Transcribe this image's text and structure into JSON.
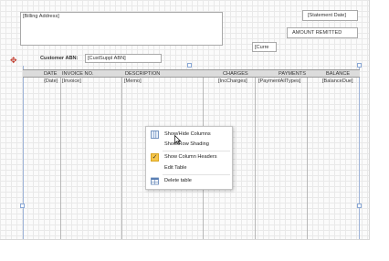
{
  "header": {
    "billing_address": "[Billing Address]",
    "statement_date": "[Statement Date]",
    "amount_remitted": "AMOUNT REMITTED",
    "currency": "[Curre",
    "customer_abn_label": "Customer ABN:",
    "customer_abn_value": "[CustSuppl ABN]"
  },
  "table": {
    "columns": [
      "DATE",
      "INVOICE NO.",
      "DESCRIPTION",
      "CHARGES",
      "PAYMENTS",
      "BALANCE"
    ],
    "row": [
      "{Date}",
      "[Invoice]",
      "[Memo]",
      "[IncCharges]",
      "[PaymentAllTypes]",
      "[BalanceDue]"
    ]
  },
  "context_menu": {
    "items": [
      {
        "label": "Show/Hide Columns",
        "icon": "columns-icon",
        "checked": false
      },
      {
        "label": "Show Row Shading",
        "icon": "",
        "checked": false
      },
      {
        "label": "Show Column Headers",
        "icon": "checkmark-icon",
        "checked": true
      },
      {
        "label": "Edit Table",
        "icon": "",
        "checked": false
      },
      {
        "label": "Delete table",
        "icon": "delete-table-icon",
        "checked": false
      }
    ]
  },
  "colors": {
    "header_fill": "#dcdcdc",
    "check_fill": "#f7c64a",
    "selection_handle": "#8aa8d6"
  }
}
